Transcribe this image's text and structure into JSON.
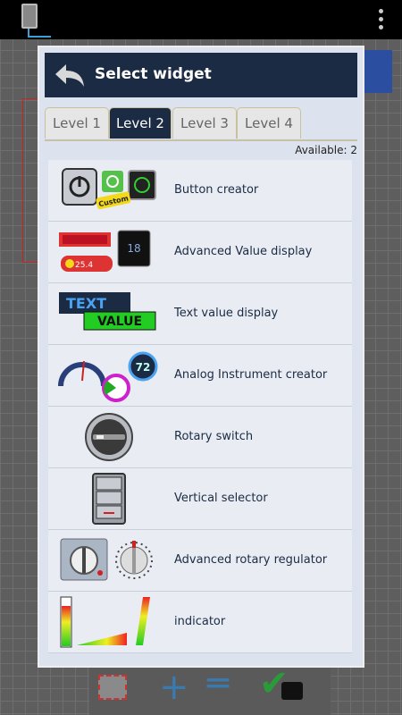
{
  "dialog": {
    "title": "Select widget",
    "available": "Available: 2",
    "tabs": [
      {
        "label": "Level 1",
        "active": false
      },
      {
        "label": "Level 2",
        "active": true
      },
      {
        "label": "Level 3",
        "active": false
      },
      {
        "label": "Level 4",
        "active": false
      }
    ],
    "widgets": [
      {
        "label": "Button creator",
        "icon": "power-button-icon",
        "badge": "Custom"
      },
      {
        "label": "Advanced Value display",
        "icon": "value-display-icon",
        "thumb_texts": [
          "25.4",
          "18"
        ]
      },
      {
        "label": "Text value display",
        "icon": "text-value-icon",
        "thumb_texts": [
          "TEXT",
          "VALUE"
        ]
      },
      {
        "label": "Analog Instrument creator",
        "icon": "gauge-icon",
        "thumb_texts": [
          "72"
        ]
      },
      {
        "label": "Rotary switch",
        "icon": "rotary-switch-icon"
      },
      {
        "label": "Vertical selector",
        "icon": "vertical-selector-icon"
      },
      {
        "label": "Advanced rotary regulator",
        "icon": "rotary-regulator-icon"
      },
      {
        "label": "indicator",
        "icon": "bar-indicator-icon"
      }
    ]
  },
  "colors": {
    "titlebar": "#1b2b44",
    "tab_active": "#1b2b44",
    "dialog_bg": "#dde3ee"
  }
}
